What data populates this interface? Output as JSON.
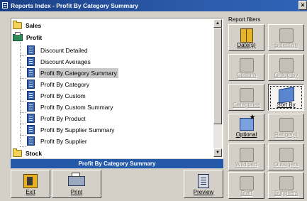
{
  "window": {
    "title": "Reports Index - Profit By Category Summary",
    "close_label": "×"
  },
  "tree": {
    "categories": [
      {
        "label": "Sales"
      },
      {
        "label": "Profit"
      },
      {
        "label": "Stock"
      }
    ],
    "profit_reports": [
      {
        "label": "Discount Detailed"
      },
      {
        "label": "Discount Averages"
      },
      {
        "label": "Profit By Category Summary"
      },
      {
        "label": "Profit By Category"
      },
      {
        "label": "Profit By Custom"
      },
      {
        "label": "Profit By Custom Summary"
      },
      {
        "label": "Profit By Product"
      },
      {
        "label": "Profit By Supplier Summary"
      },
      {
        "label": "Profit By Supplier"
      }
    ],
    "selected": "Profit By Category Summary"
  },
  "scrollbar": {
    "up_glyph": "▲",
    "down_glyph": "▼"
  },
  "status": {
    "current_report": "Profit By Category Summary"
  },
  "bottom_buttons": {
    "exit": "Exit",
    "print": "Print",
    "preview": "Preview"
  },
  "report_filters": {
    "label": "Report filters",
    "buttons": [
      {
        "label": "Date(s)",
        "enabled": true
      },
      {
        "label": "Selection",
        "enabled": false
      },
      {
        "label": "Custom",
        "enabled": false
      },
      {
        "label": "Group By",
        "enabled": false
      },
      {
        "label": "Categories",
        "enabled": false
      },
      {
        "label": "Sort By",
        "enabled": true,
        "active": true
      },
      {
        "label": "Optional",
        "enabled": true
      },
      {
        "label": "Range(s)",
        "enabled": false
      },
      {
        "label": "Wildcard",
        "enabled": false
      },
      {
        "label": "Outstgers",
        "enabled": false
      },
      {
        "label": "Staff",
        "enabled": false
      },
      {
        "label": "Suppliers",
        "enabled": false
      }
    ]
  },
  "colors": {
    "title_bar": "#1a3f86",
    "status_bar": "#2458a8",
    "face": "#d4d0c8"
  }
}
